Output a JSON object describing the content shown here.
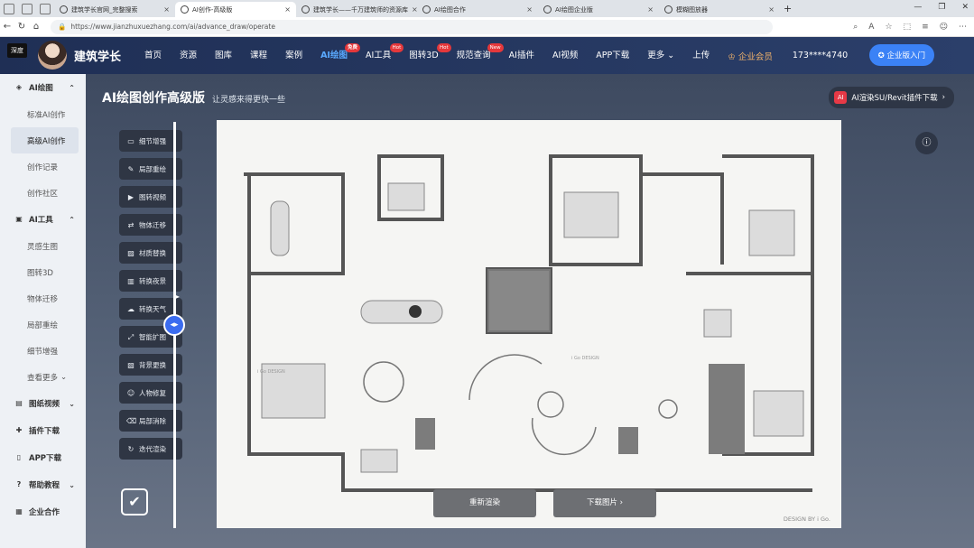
{
  "browser": {
    "tabs": [
      {
        "label": "建筑学长官网_完整搜索",
        "active": false
      },
      {
        "label": "AI创作-高级版",
        "active": true
      },
      {
        "label": "建筑学长——千万建筑师的资源库",
        "active": false
      },
      {
        "label": "AI绘图合作",
        "active": false
      },
      {
        "label": "AI绘图企业版",
        "active": false
      },
      {
        "label": "模糊图放器",
        "active": false
      }
    ],
    "url": "https://www.jianzhuxuezhang.com/ai/advance_draw/operate"
  },
  "header": {
    "brand_badge": "深度",
    "brand_name": "建筑学长",
    "menu": [
      {
        "label": "首页",
        "badge": ""
      },
      {
        "label": "资源",
        "badge": ""
      },
      {
        "label": "图库",
        "badge": ""
      },
      {
        "label": "课程",
        "badge": ""
      },
      {
        "label": "案例",
        "badge": ""
      },
      {
        "label": "AI绘图",
        "badge": "免费",
        "active": true
      },
      {
        "label": "AI工具",
        "badge": "Hot"
      },
      {
        "label": "图转3D",
        "badge": "Hot"
      },
      {
        "label": "规范查询",
        "badge": "New"
      },
      {
        "label": "AI插件",
        "badge": ""
      },
      {
        "label": "AI视频",
        "badge": ""
      },
      {
        "label": "APP下载",
        "badge": ""
      },
      {
        "label": "更多",
        "badge": ""
      },
      {
        "label": "上传",
        "badge": ""
      }
    ],
    "vip_label": "企业会员",
    "phone": "173****4740",
    "enterprise_button": "企业版入门"
  },
  "sidebar": {
    "groups": [
      {
        "label": "AI绘图",
        "icon": "palette-icon",
        "items": [
          "标准AI创作",
          "高级AI创作",
          "创作记录",
          "创作社区"
        ]
      },
      {
        "label": "AI工具",
        "icon": "toolbox-icon",
        "items": [
          "灵感生图",
          "图转3D",
          "物体迁移",
          "局部重绘",
          "细节增强",
          "查看更多"
        ]
      },
      {
        "label": "图纸视频",
        "icon": "video-icon",
        "items": []
      },
      {
        "label": "插件下载",
        "icon": "puzzle-icon",
        "items": []
      },
      {
        "label": "APP下载",
        "icon": "phone-icon",
        "items": []
      },
      {
        "label": "帮助教程",
        "icon": "help-icon",
        "items": []
      },
      {
        "label": "企业合作",
        "icon": "building-icon",
        "items": []
      }
    ],
    "active_item": "高级AI创作"
  },
  "main": {
    "title": "AI绘图创作高级版",
    "subtitle": "让灵感来得更快一些",
    "plugin_button": "AI渲染SU/Revit插件下载",
    "tools": [
      "细节增强",
      "局部重绘",
      "图转视频",
      "物体迁移",
      "材质替换",
      "转换夜景",
      "转换天气",
      "智能扩图",
      "背景更换",
      "人物修复",
      "局部消除",
      "迭代渲染"
    ],
    "regenerate_button": "重新渲染",
    "download_button": "下载图片",
    "watermark": "DESIGN BY i Go."
  },
  "colors": {
    "header_bg": "#1f2f55",
    "accent_blue": "#3b82f6",
    "badge_red": "#e5383b",
    "vip_gold": "#f2b36a"
  }
}
